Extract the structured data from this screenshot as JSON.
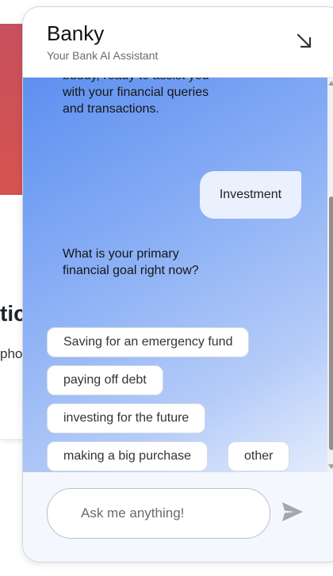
{
  "background": {
    "heading_fragment": "tic",
    "sub_fragment": "pho"
  },
  "chat": {
    "title": "Banky",
    "subtitle": "Your Bank AI Assistant",
    "messages": {
      "bot_first": "buddy, ready to assist you with your financial queries and transactions.",
      "user": "Investment",
      "bot_second": "What is your primary financial goal right now?"
    },
    "options": [
      "Saving for an emergency fund",
      "paying off debt",
      "investing for the future",
      "making a big purchase",
      "other"
    ],
    "input_placeholder": "Ask me anything!",
    "icons": {
      "minimize": "arrow-down-right-icon",
      "send": "send-icon"
    },
    "colors": {
      "gradient_start": "#5d8ff0",
      "gradient_end": "#e4ecfd",
      "send_icon": "#a3a7ad"
    }
  }
}
